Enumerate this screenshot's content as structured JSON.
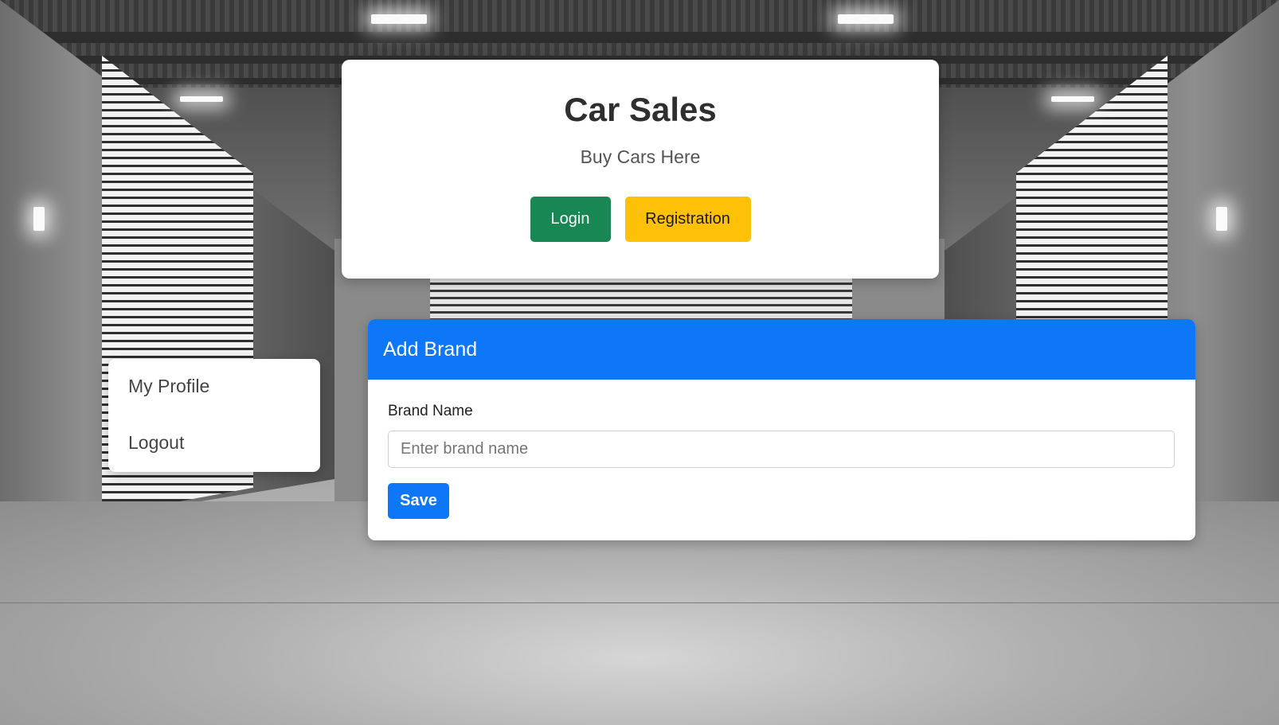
{
  "header": {
    "title": "Car Sales",
    "subtitle": "Buy Cars Here",
    "login_label": "Login",
    "registration_label": "Registration"
  },
  "sidebar": {
    "items": [
      {
        "label": "My Profile"
      },
      {
        "label": "Logout"
      }
    ]
  },
  "brand_form": {
    "title": "Add Brand",
    "field_label": "Brand Name",
    "placeholder": "Enter brand name",
    "value": "",
    "save_label": "Save"
  },
  "colors": {
    "primary": "#0d77f7",
    "success": "#198754",
    "warning": "#ffc107"
  }
}
